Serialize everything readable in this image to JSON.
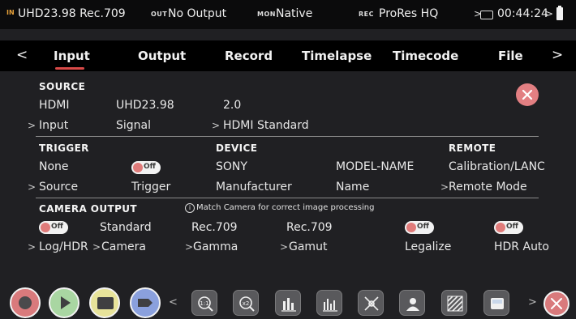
{
  "status": {
    "input_tag": "IN",
    "input_format": "UHD23.98 Rec.709",
    "output_tag": "OUT",
    "output_value": "No Output",
    "monitor_tag": "MON",
    "monitor_value": "Native",
    "record_tag": "REC",
    "record_codec": "ProRes HQ",
    "media_icon": "ssd-icon",
    "time_remaining": "00:44:24",
    "battery_icon": "battery-icon"
  },
  "tabs": [
    "Input",
    "Output",
    "Record",
    "Timelapse",
    "Timecode",
    "File"
  ],
  "active_tab": "Input",
  "source": {
    "header": "SOURCE",
    "input_value": "HDMI",
    "input_label": "Input",
    "signal_value": "UHD23.98",
    "signal_label": "Signal",
    "hdmi_standard_value": "2.0",
    "hdmi_standard_label": "HDMI Standard"
  },
  "trigger": {
    "header": "TRIGGER",
    "source_value": "None",
    "source_label": "Source",
    "trigger_toggle": "Off",
    "trigger_label": "Trigger"
  },
  "device": {
    "header": "DEVICE",
    "manufacturer_value": "SONY",
    "manufacturer_label": "Manufacturer",
    "name_value": "MODEL-NAME",
    "name_label": "Name"
  },
  "remote": {
    "header": "REMOTE",
    "mode_value": "Calibration/LANC",
    "mode_label": "Remote Mode"
  },
  "camera_output": {
    "header": "CAMERA OUTPUT",
    "hint": "Match Camera for correct image processing",
    "log_hdr_toggle": "Off",
    "log_hdr_label": "Log/HDR",
    "camera_value": "Standard",
    "camera_label": "Camera",
    "gamma_value": "Rec.709",
    "gamma_label": "Gamma",
    "gamut_value": "Rec.709",
    "gamut_label": "Gamut",
    "legalize_toggle": "Off",
    "legalize_label": "Legalize",
    "hdr_auto_toggle": "Off",
    "hdr_auto_label": "HDR Auto"
  },
  "toolbar": {
    "icons": [
      "record-icon",
      "play-icon",
      "display-mode-icon",
      "tag-icon",
      "zoom-1to1-icon",
      "zoom-2x-icon",
      "waveform-icon",
      "vectorscope-icon",
      "focus-peaking-icon",
      "false-color-icon",
      "zebra-icon",
      "lut-icon",
      "close-icon"
    ],
    "colors": {
      "record": "#d97a7c",
      "play": "#a9d6a2",
      "display": "#e7e39a",
      "tag": "#8aa0dd",
      "accent": "#d94a48"
    }
  }
}
